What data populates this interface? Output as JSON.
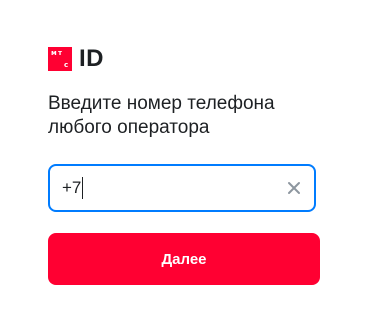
{
  "logo": {
    "glyphs": [
      "м",
      "т",
      "с"
    ],
    "text": "ID",
    "brand_color": "#ff0032"
  },
  "heading": "Введите номер телефона любого оператора",
  "phone": {
    "value": "+7",
    "focused_border_color": "#007cff",
    "clear_icon": "close-icon"
  },
  "submit": {
    "label": "Далее"
  }
}
